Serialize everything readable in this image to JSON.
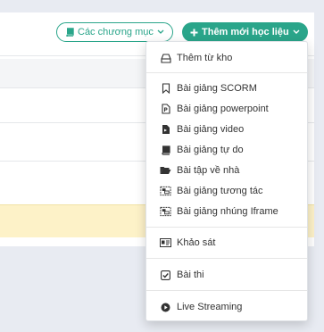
{
  "header": {
    "categories_button": "Các chương mục",
    "add_button": "Thêm mới học liệu"
  },
  "menu": {
    "items": [
      {
        "label": "Thêm từ kho",
        "icon": "drive-icon"
      },
      {
        "label": "Bài giảng SCORM",
        "icon": "bookmark-icon"
      },
      {
        "label": "Bài giảng powerpoint",
        "icon": "file-powerpoint-icon"
      },
      {
        "label": "Bài giảng video",
        "icon": "file-video-icon"
      },
      {
        "label": "Bài giảng tự do",
        "icon": "book-icon"
      },
      {
        "label": "Bài tập về nhà",
        "icon": "folder-open-icon"
      },
      {
        "label": "Bài giảng tương tác",
        "icon": "object-group-icon"
      },
      {
        "label": "Bài giảng nhúng Iframe",
        "icon": "object-group-icon"
      },
      {
        "label": "Khảo sát",
        "icon": "id-card-icon"
      },
      {
        "label": "Bài thi",
        "icon": "check-square-icon"
      },
      {
        "label": "Live Streaming",
        "icon": "play-circle-icon"
      }
    ]
  },
  "colors": {
    "accent": "#2aa58a",
    "banner": "#fdf2c8",
    "background": "#e8ebf2"
  }
}
